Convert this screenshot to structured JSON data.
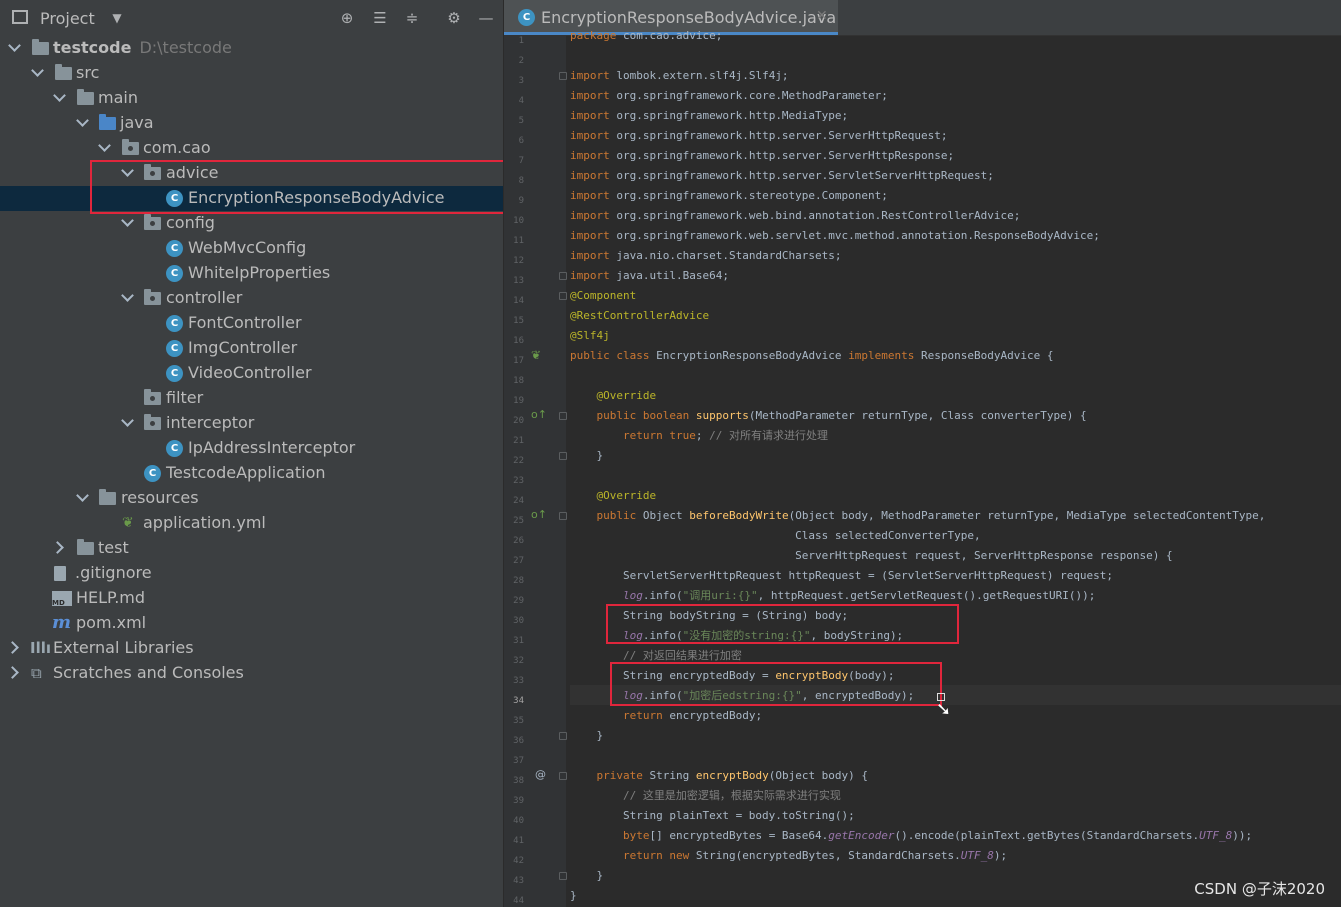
{
  "project_panel": {
    "title": "Project",
    "tree": [
      {
        "label": "testcode",
        "path": "D:\\testcode"
      },
      {
        "label": "src"
      },
      {
        "label": "main"
      },
      {
        "label": "java"
      },
      {
        "label": "com.cao"
      },
      {
        "label": "advice"
      },
      {
        "label": "EncryptionResponseBodyAdvice"
      },
      {
        "label": "config"
      },
      {
        "label": "WebMvcConfig"
      },
      {
        "label": "WhiteIpProperties"
      },
      {
        "label": "controller"
      },
      {
        "label": "FontController"
      },
      {
        "label": "ImgController"
      },
      {
        "label": "VideoController"
      },
      {
        "label": "filter"
      },
      {
        "label": "interceptor"
      },
      {
        "label": "IpAddressInterceptor"
      },
      {
        "label": "TestcodeApplication"
      },
      {
        "label": "resources"
      },
      {
        "label": "application.yml"
      },
      {
        "label": "test"
      },
      {
        "label": ".gitignore"
      },
      {
        "label": "HELP.md"
      },
      {
        "label": "pom.xml"
      },
      {
        "label": "External Libraries"
      },
      {
        "label": "Scratches and Consoles"
      }
    ]
  },
  "editor": {
    "tab_label": "EncryptionResponseBodyAdvice.java",
    "line_numbers": [
      "1",
      "2",
      "3",
      "4",
      "5",
      "6",
      "7",
      "8",
      "9",
      "10",
      "11",
      "12",
      "13",
      "14",
      "15",
      "16",
      "17",
      "18",
      "19",
      "20",
      "21",
      "22",
      "23",
      "24",
      "25",
      "26",
      "27",
      "28",
      "29",
      "30",
      "31",
      "32",
      "33",
      "34",
      "35",
      "36",
      "37",
      "38",
      "39",
      "40",
      "41",
      "42",
      "43",
      "44"
    ]
  },
  "code_lines": [
    "package com.cao.advice;",
    "",
    "import lombok.extern.slf4j.Slf4j;",
    "import org.springframework.core.MethodParameter;",
    "import org.springframework.http.MediaType;",
    "import org.springframework.http.server.ServerHttpRequest;",
    "import org.springframework.http.server.ServerHttpResponse;",
    "import org.springframework.http.server.ServletServerHttpRequest;",
    "import org.springframework.stereotype.Component;",
    "import org.springframework.web.bind.annotation.RestControllerAdvice;",
    "import org.springframework.web.servlet.mvc.method.annotation.ResponseBodyAdvice;",
    "import java.nio.charset.StandardCharsets;",
    "import java.util.Base64;",
    "@Component",
    "@RestControllerAdvice",
    "@Slf4j",
    "public class EncryptionResponseBodyAdvice implements ResponseBodyAdvice {",
    "",
    "    @Override",
    "    public boolean supports(MethodParameter returnType, Class converterType) {",
    "        return true; // 对所有请求进行处理",
    "    }",
    "",
    "    @Override",
    "    public Object beforeBodyWrite(Object body, MethodParameter returnType, MediaType selectedContentType,",
    "                                  Class selectedConverterType,",
    "                                  ServerHttpRequest request, ServerHttpResponse response) {",
    "        ServletServerHttpRequest httpRequest = (ServletServerHttpRequest) request;",
    "        log.info(\"调用uri:{}\", httpRequest.getServletRequest().getRequestURI());",
    "        String bodyString = (String) body;",
    "        log.info(\"没有加密的string:{}\", bodyString);",
    "        // 对返回结果进行加密",
    "        String encryptedBody = encryptBody(body);",
    "        log.info(\"加密后edstring:{}\", encryptedBody);",
    "        return encryptedBody;",
    "    }",
    "",
    "    private String encryptBody(Object body) {",
    "        // 这里是加密逻辑，根据实际需求进行实现",
    "        String plainText = body.toString();",
    "        byte[] encryptedBytes = Base64.getEncoder().encode(plainText.getBytes(StandardCharsets.UTF_8));",
    "        return new String(encryptedBytes, StandardCharsets.UTF_8);",
    "    }",
    "}"
  ],
  "watermark": "CSDN @子沫2020",
  "colors": {
    "highlight_box": "#e0263c",
    "selection": "#0d293e",
    "tab_underline": "#4a88c7"
  }
}
